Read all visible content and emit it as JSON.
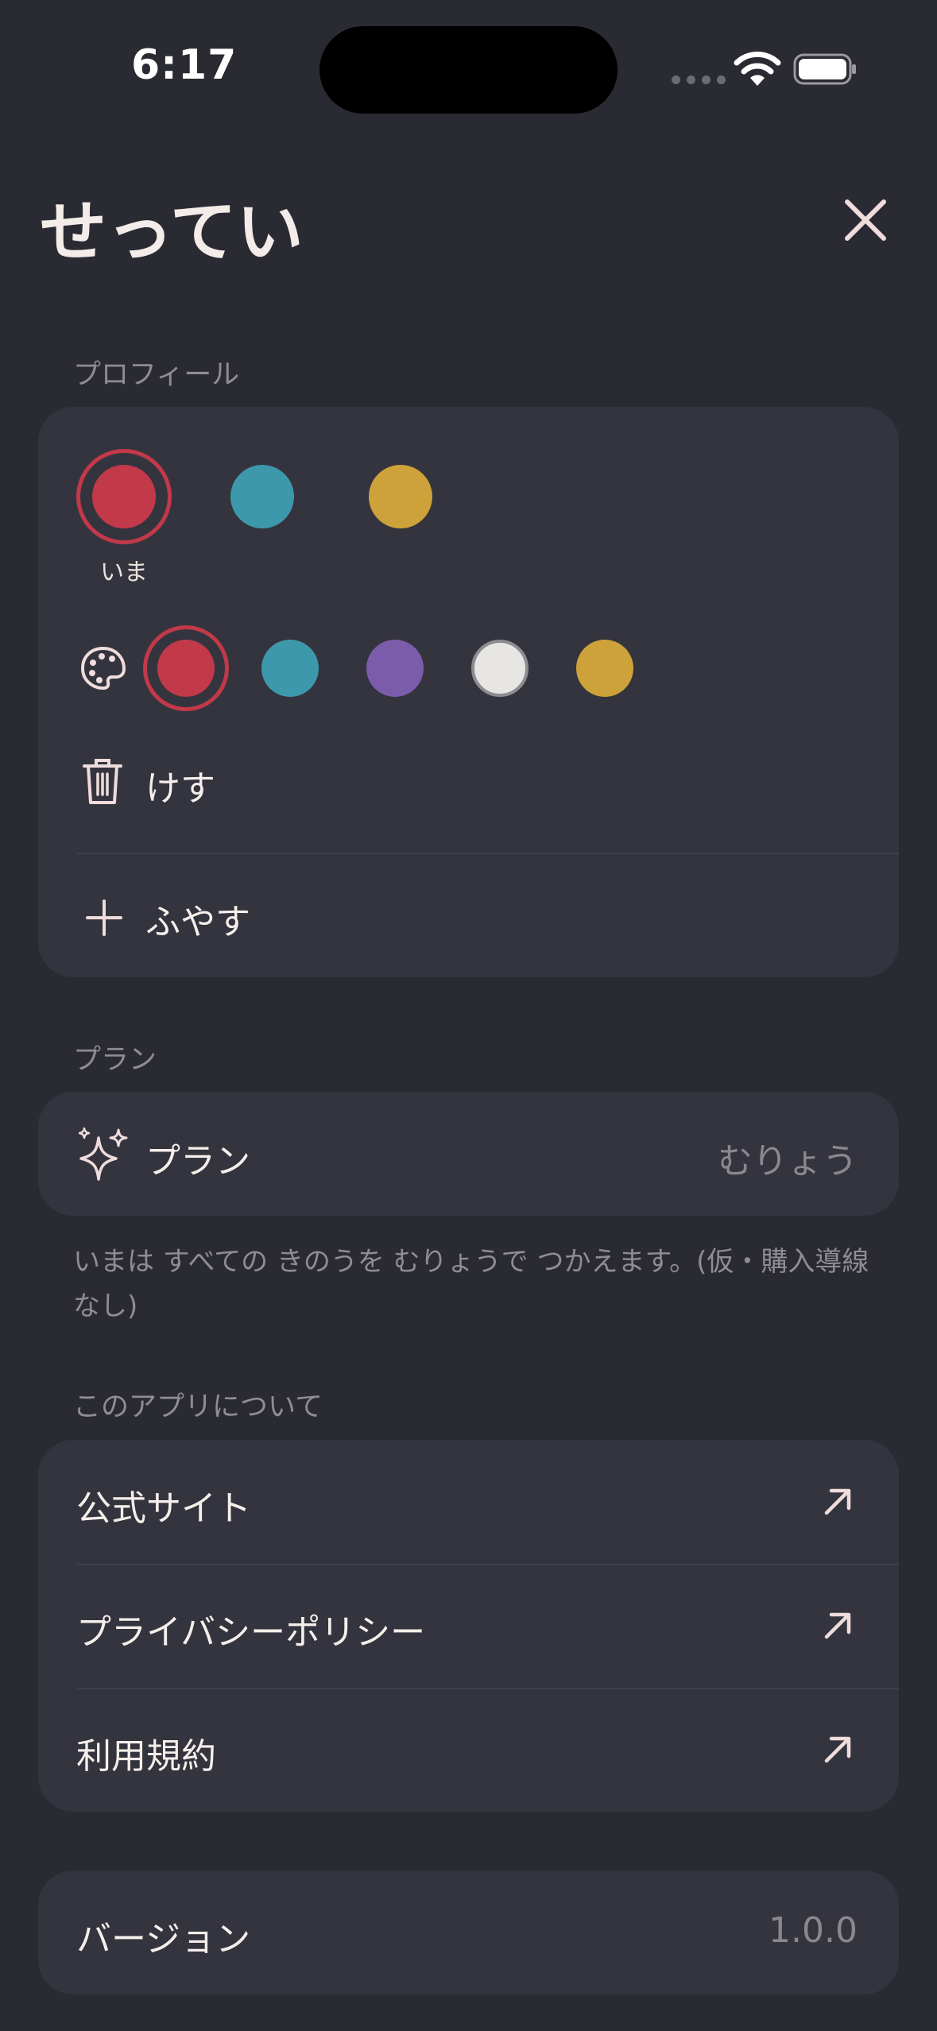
{
  "status_bar": {
    "time": "6:17"
  },
  "header": {
    "title": "せってい"
  },
  "profile": {
    "section_label": "プロフィール",
    "current_label": "いま",
    "profiles": [
      {
        "color": "#c2394a",
        "current": true
      },
      {
        "color": "#3e98ab"
      },
      {
        "color": "#cea23a"
      }
    ],
    "palette_colors": [
      {
        "color": "#c2394a",
        "selected": true
      },
      {
        "color": "#3e98ab"
      },
      {
        "color": "#7a5cab"
      },
      {
        "color": "#e8e6e3"
      },
      {
        "color": "#cea23a"
      }
    ],
    "delete_label": "けす",
    "add_label": "ふやす"
  },
  "plan": {
    "section_label": "プラン",
    "row_label": "プラン",
    "row_value": "むりょう",
    "note": "いまは すべての きのうを むりょうで つかえます。(仮・購入導線なし)"
  },
  "about": {
    "section_label": "このアプリについて",
    "links": [
      {
        "label": "公式サイト"
      },
      {
        "label": "プライバシーポリシー"
      },
      {
        "label": "利用規約"
      }
    ]
  },
  "version": {
    "label": "バージョン",
    "value": "1.0.0"
  },
  "colors": {
    "background": "#2a2a33",
    "card": "#34343e",
    "accent": "#c2394a",
    "icon": "#efdcdc"
  }
}
